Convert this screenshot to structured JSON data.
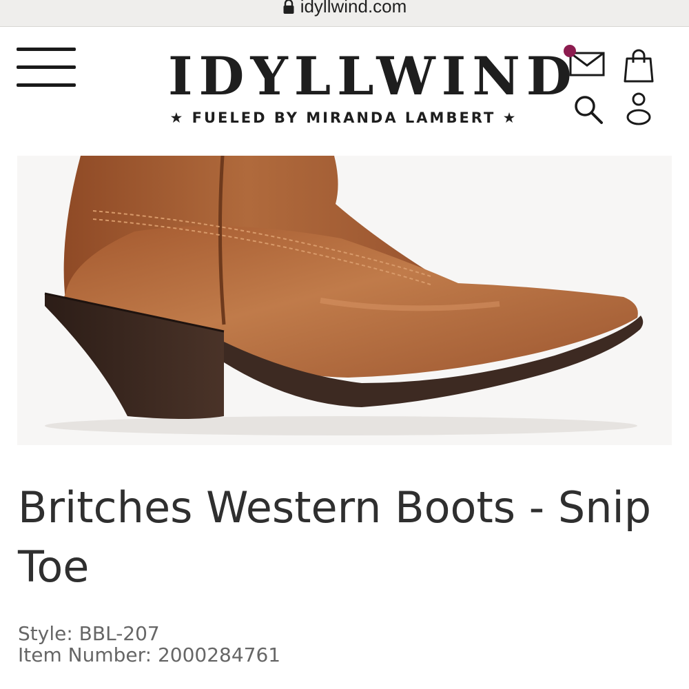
{
  "browser": {
    "url": "idyllwind.com"
  },
  "header": {
    "logo_text": "IDYLLWIND",
    "tagline": "★ FUELED BY MIRANDA LAMBERT ★",
    "icons": [
      "menu-icon",
      "mail-icon",
      "shopping-bag-icon",
      "search-icon",
      "account-icon"
    ],
    "notification_color": "#8c1c4f"
  },
  "product": {
    "title": "Britches Western Boots - Snip Toe",
    "style_label": "Style:",
    "style_value": "BBL-207",
    "item_number_label": "Item Number:",
    "item_number_value": "2000284761"
  },
  "colors": {
    "leather": "#b36a3c",
    "sole": "#3d2a22",
    "text": "#2f2f2f"
  }
}
